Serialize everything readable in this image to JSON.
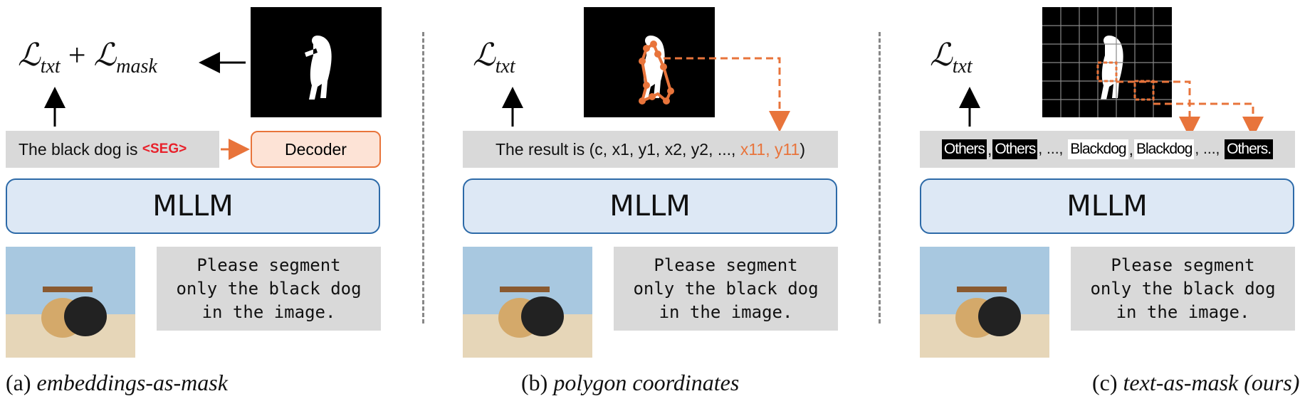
{
  "colors": {
    "accent_orange": "#e8743b",
    "seg_red": "#e8202a",
    "mllm_fill": "#dde8f5",
    "mllm_border": "#2d6aa8",
    "bar_gray": "#d9d9d9"
  },
  "mllm_label": "MLLM",
  "prompt_text": "Please segment\nonly the black dog\nin the image.",
  "panel_a": {
    "caption_letter": "(a)",
    "caption_text": "embeddings-as-mask",
    "loss_txt": "txt",
    "loss_mask": "mask",
    "bar_text": "The black dog is ",
    "seg_token": "<SEG>",
    "decoder_label": "Decoder"
  },
  "panel_b": {
    "caption_letter": "(b)",
    "caption_text": "polygon coordinates",
    "loss_txt": "txt",
    "bar_prefix": "The result is (c, x1, y1, x2, y2, ..., ",
    "bar_highlight": "x11, y11",
    "bar_suffix": ")"
  },
  "panel_c": {
    "caption_letter": "(c)",
    "caption_text": "text-as-mask (ours)",
    "loss_txt": "txt",
    "tokens": [
      "Others",
      ",",
      "Others",
      ", ..., ",
      "Blackdog",
      ",",
      "Blackdog",
      ", ..., ",
      "Others."
    ]
  }
}
